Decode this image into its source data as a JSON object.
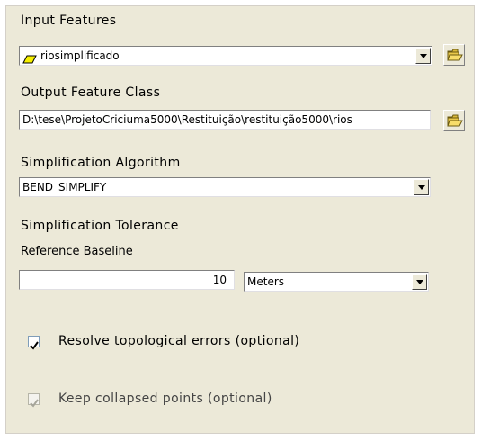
{
  "input_features": {
    "label": "Input Features",
    "value": "riosimplificado",
    "layer_icon": "polyline-layer-icon",
    "browse_icon": "open-folder-icon"
  },
  "output_feature_class": {
    "label": "Output Feature Class",
    "value": "D:\\tese\\ProjetoCriciuma5000\\Restituição\\restituição5000\\rios",
    "browse_icon": "open-folder-icon"
  },
  "simplification_algorithm": {
    "label": "Simplification Algorithm",
    "value": "BEND_SIMPLIFY"
  },
  "simplification_tolerance": {
    "label": "Simplification Tolerance",
    "sublabel": "Reference Baseline",
    "value": "10",
    "unit": "Meters"
  },
  "resolve_errors": {
    "label": "Resolve topological errors (optional)",
    "checked": true
  },
  "keep_collapsed": {
    "label": "Keep collapsed points (optional)",
    "checked": true,
    "enabled": false
  },
  "colors": {
    "panel": "#ece9d8",
    "field_bg": "#ffffff",
    "disabled_text": "#444444"
  }
}
